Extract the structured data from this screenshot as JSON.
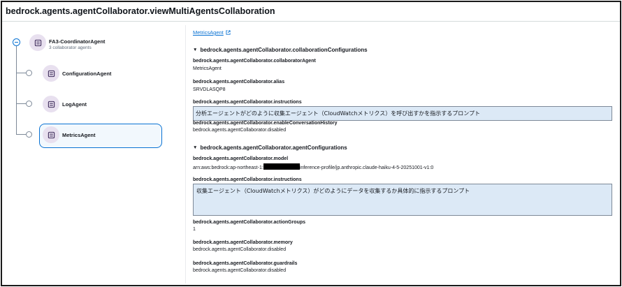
{
  "page": {
    "title": "bedrock.agents.agentCollaborator.viewMultiAgentsCollaboration"
  },
  "tree": {
    "root": {
      "name": "FA3-CoordinatorAgent",
      "subtitle": "3 collaborator agents",
      "icon": "agent-icon"
    },
    "children": [
      {
        "name": "ConfigurationAgent",
        "icon": "agent-icon",
        "selected": false
      },
      {
        "name": "LogAgent",
        "icon": "agent-icon",
        "selected": false
      },
      {
        "name": "MetricsAgent",
        "icon": "agent-icon",
        "selected": true
      }
    ]
  },
  "detail": {
    "link_label": "MetricsAgent",
    "link_icon": "external-link-icon",
    "collab_section": {
      "heading": "bedrock.agents.agentCollaborator.collaborationConfigurations",
      "fields": [
        {
          "key": "bedrock.agents.agentCollaborator.collaboratorAgent",
          "value": "MetricsAgent"
        },
        {
          "key": "bedrock.agents.agentCollaborator.alias",
          "value": "SRVDLASQP8"
        },
        {
          "key": "bedrock.agents.agentCollaborator.instructions",
          "value": "分析エージェントがどのように収集エージェント（CloudWatchメトリクス）を呼び出すかを指示するプロンプト"
        },
        {
          "key": "bedrock.agents.agentCollaborator.enableConversationHistory",
          "value": "bedrock.agents.agentCollaborator.disabled"
        }
      ]
    },
    "agent_section": {
      "heading": "bedrock.agents.agentCollaborator.agentConfigurations",
      "model_key": "bedrock.agents.agentCollaborator.model",
      "model_prefix": "arn:aws:bedrock:ap-northeast-1:",
      "model_suffix": "inference-profile/jp.anthropic.claude-haiku-4-5-20251001-v1:0",
      "instructions_key": "bedrock.agents.agentCollaborator.instructions",
      "instructions_value": "収集エージェント（CloudWatchメトリクス）がどのようにデータを収集するか具体的に指示するプロンプト",
      "fields": [
        {
          "key": "bedrock.agents.agentCollaborator.actionGroups",
          "value": "1"
        },
        {
          "key": "bedrock.agents.agentCollaborator.memory",
          "value": "bedrock.agents.agentCollaborator.disabled"
        },
        {
          "key": "bedrock.agents.agentCollaborator.guardrails",
          "value": "bedrock.agents.agentCollaborator.disabled"
        }
      ]
    }
  },
  "colors": {
    "accent": "#0972d3",
    "highlight_box": "#dce9f6",
    "icon_bg": "#e8e0ef"
  }
}
